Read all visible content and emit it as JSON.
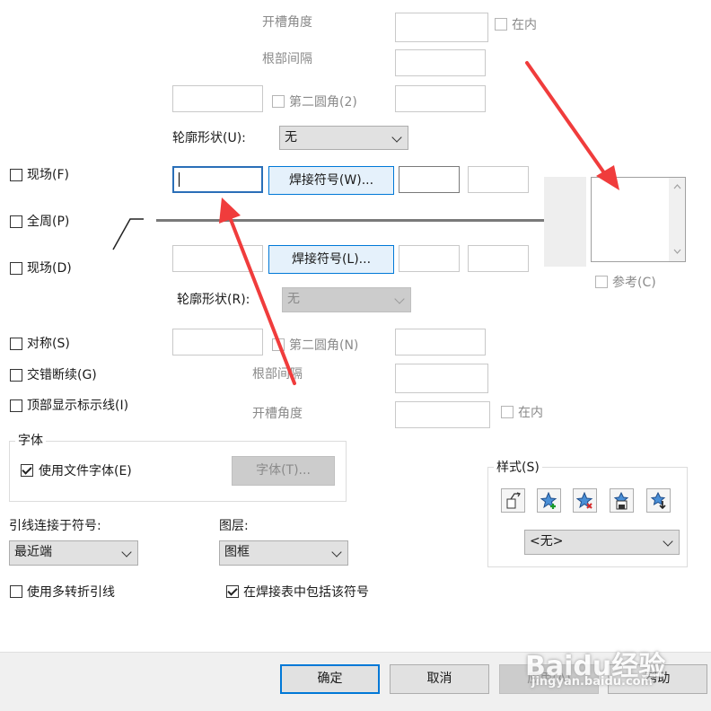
{
  "top_section": {
    "groove_angle_label": "开槽角度",
    "root_spacing_label": "根部间隔",
    "inside_label": "在内",
    "second_fillet_label": "第二圆角(2)",
    "contour_shape_label": "轮廓形状(U):",
    "contour_shape_value": "无",
    "weld_symbol_button": "焊接符号(W)..."
  },
  "left_options": {
    "field_top": "现场(F)",
    "all_around": "全周(P)",
    "field_bottom": "现场(D)",
    "symmetric": "对称(S)",
    "staggered": "交错断续(G)",
    "top_display_line": "顶部显示标示线(I)"
  },
  "bottom_section": {
    "weld_symbol_button": "焊接符号(L)...",
    "contour_shape_label": "轮廓形状(R):",
    "contour_shape_value": "无",
    "second_fillet_label": "第二圆角(N)",
    "root_spacing_label": "根部间隔",
    "groove_angle_label": "开槽角度",
    "inside_label": "在内"
  },
  "reference_label": "参考(C)",
  "font_group": {
    "title": "字体",
    "use_doc_font": "使用文件字体(E)",
    "font_button": "字体(T)..."
  },
  "leader": {
    "label": "引线连接于符号:",
    "value": "最近端"
  },
  "layer": {
    "label": "图层:",
    "value": "图框"
  },
  "multi_jog": "使用多转折引线",
  "include_in_table": "在焊接表中包括该符号",
  "style_group": {
    "title": "样式(S)",
    "value": "<无>"
  },
  "footer": {
    "ok": "确定",
    "cancel": "取消",
    "apply": "应用(A)",
    "help": "帮助"
  },
  "watermark": {
    "brand": "Baidu经验",
    "url": "jingyan.baidu.com"
  },
  "colors": {
    "annotation_arrow": "#f03c3c",
    "focus_blue": "#0078d7"
  }
}
